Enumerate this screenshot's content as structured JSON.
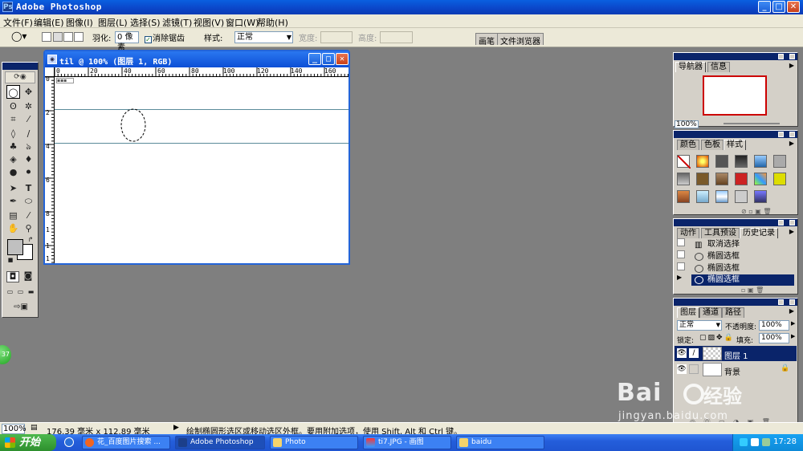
{
  "titlebar": {
    "title": "Adobe Photoshop"
  },
  "menus": [
    "文件(F)",
    "编辑(E)",
    "图像(I)",
    "图层(L)",
    "选择(S)",
    "滤镜(T)",
    "视图(V)",
    "窗口(W)",
    "帮助(H)"
  ],
  "options": {
    "feather_label": "羽化:",
    "feather_value": "0 像素",
    "antialias_label": "消除锯齿",
    "antialias_checked": true,
    "style_label": "样式:",
    "style_value": "正常",
    "width_label": "宽度:",
    "height_label": "高度:",
    "well_tabs": [
      "画笔",
      "文件浏览器"
    ]
  },
  "document": {
    "title": "til @ 100% (图层 1, RGB)",
    "ruler_top": [
      "0",
      "20",
      "40",
      "60",
      "80",
      "100",
      "120",
      "140",
      "160"
    ],
    "ruler_left": [
      "0",
      "2",
      "4",
      "6",
      "8",
      "1",
      "1",
      "1"
    ]
  },
  "navigator": {
    "tabs": [
      "导航器",
      "信息"
    ],
    "zoom": "100%"
  },
  "swatches": {
    "tabs": [
      "颜色",
      "色板",
      "样式"
    ]
  },
  "history": {
    "tabs": [
      "动作",
      "工具预设",
      "历史记录"
    ],
    "items": [
      "取消选择",
      "椭圆选框",
      "椭圆选框",
      "椭圆选框"
    ],
    "selected_index": 3
  },
  "layers": {
    "tabs": [
      "图层",
      "通道",
      "路径"
    ],
    "blend_mode": "正常",
    "opacity_label": "不透明度:",
    "opacity": "100%",
    "lock_label": "锁定:",
    "fill_label": "填充:",
    "fill": "100%",
    "items": [
      {
        "name": "图层 1",
        "selected": true
      },
      {
        "name": "背景",
        "selected": false
      }
    ]
  },
  "status": {
    "zoom": "100%",
    "doc_size": "176.39 毫米 x 112.89 毫米",
    "hint": "绘制椭圆形选区或移动选区外框。要用附加选项，使用 Shift, Alt 和 Ctrl 键。"
  },
  "taskbar": {
    "start": "开始",
    "tasks": [
      "花_百度图片搜索 ...",
      "Adobe Photoshop",
      "Photo",
      "ti7.JPG - 画图",
      "baidu"
    ],
    "clock": "17:28"
  },
  "watermark": {
    "brand": "Bai",
    "brand2": "经验",
    "url": "jingyan.baidu.com"
  },
  "green_ball": "37",
  "colors": {
    "title_blue": "#0b45c8",
    "panel_gray": "#d4d0c8",
    "workspace": "#7f7f7f"
  }
}
